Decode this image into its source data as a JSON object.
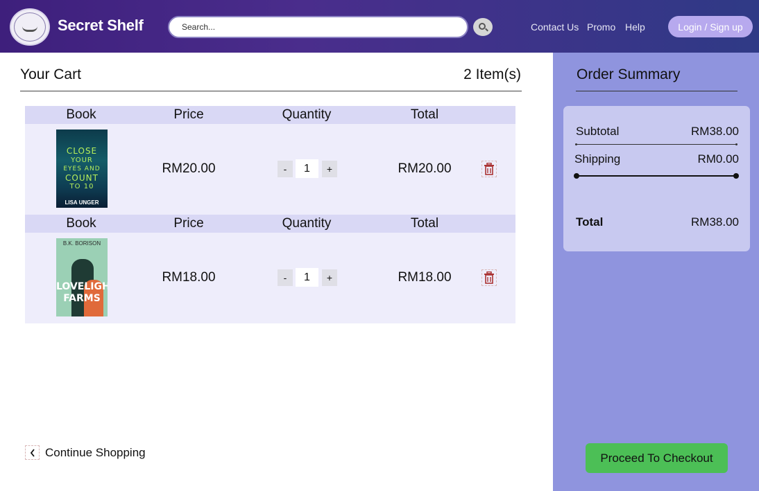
{
  "header": {
    "brand": "Secret Shelf",
    "search_placeholder": "Search...",
    "nav": [
      "Contact Us",
      "Promo",
      "Help"
    ],
    "login_label": "Login / Sign up"
  },
  "cart": {
    "title": "Your Cart",
    "count_label": "2 Item(s)",
    "columns": [
      "Book",
      "Price",
      "Quantity",
      "Total"
    ],
    "items": [
      {
        "price": "RM20.00",
        "quantity": "1",
        "total": "RM20.00",
        "cover": {
          "lines": [
            "CLOSE",
            "YOUR",
            "EYES AND",
            "COUNT",
            "TO 10"
          ],
          "author": "LISA UNGER"
        }
      },
      {
        "price": "RM18.00",
        "quantity": "1",
        "total": "RM18.00",
        "cover": {
          "author": "B.K. BORISON",
          "title_lines": [
            "LOVELIGHT",
            "FARMS"
          ]
        }
      }
    ],
    "minus_label": "-",
    "plus_label": "+",
    "continue_label": "Continue Shopping"
  },
  "summary": {
    "title": "Order Summary",
    "subtotal_label": "Subtotal",
    "subtotal_value": "RM38.00",
    "shipping_label": "Shipping",
    "shipping_value": "RM0.00",
    "total_label": "Total",
    "total_value": "RM38.00",
    "checkout_label": "Proceed To Checkout"
  },
  "colors": {
    "header_gradient": [
      "#3e1f7c",
      "#2f3a86"
    ],
    "sidebar": "#8f94de",
    "checkout": "#4cbf56",
    "login": "#b7a9ee"
  }
}
